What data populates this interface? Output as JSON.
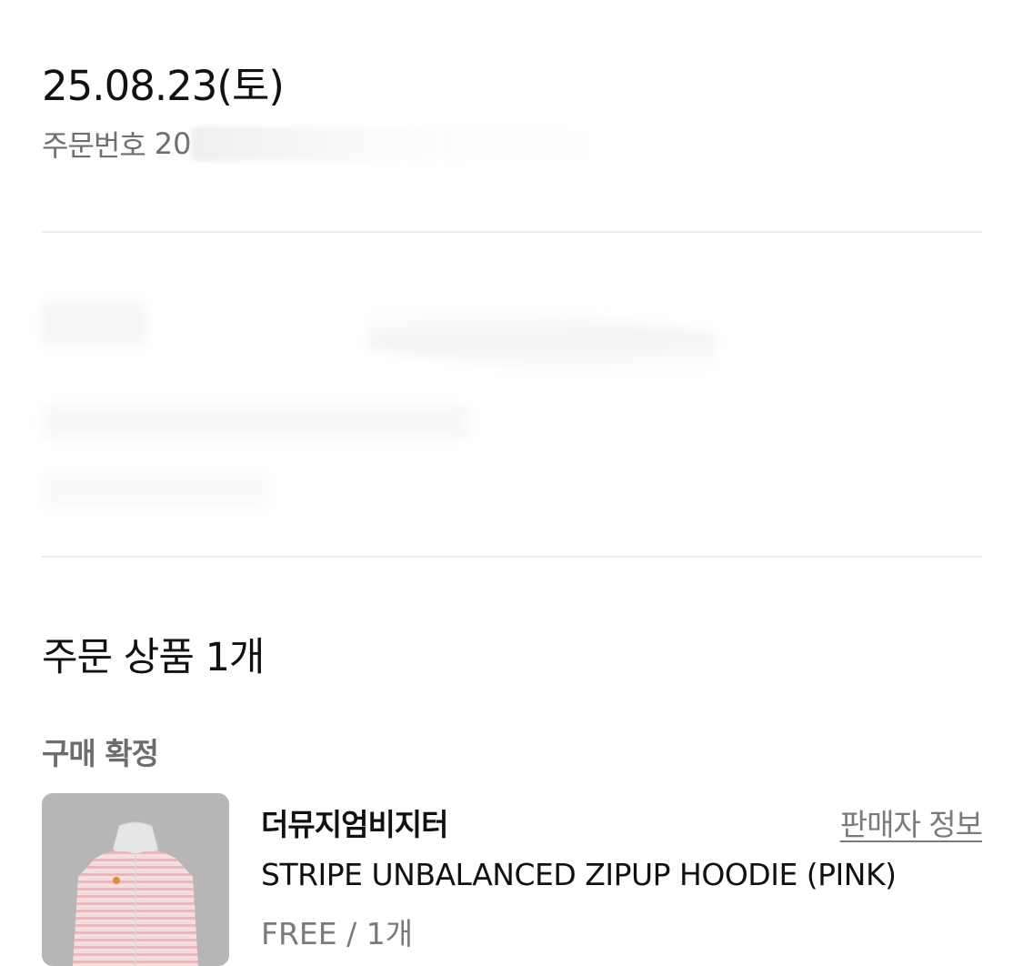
{
  "order": {
    "date": "25.08.23(토)",
    "number_label": "주문번호",
    "number_visible": "20"
  },
  "products_section": {
    "title": "주문 상품 1개",
    "status": "구매 확정",
    "items": [
      {
        "seller": "더뮤지엄비지터",
        "seller_info_label": "판매자 정보",
        "name": "STRIPE UNBALANCED ZIPUP HOODIE (PINK)",
        "option": "FREE / 1개",
        "thumbnail_icon": "pink-striped-hoodie-image"
      }
    ]
  },
  "colors": {
    "text_primary": "#111111",
    "text_secondary": "#6f6f6f",
    "divider": "#ececec",
    "thumb_bg": "#b6b6b6"
  }
}
